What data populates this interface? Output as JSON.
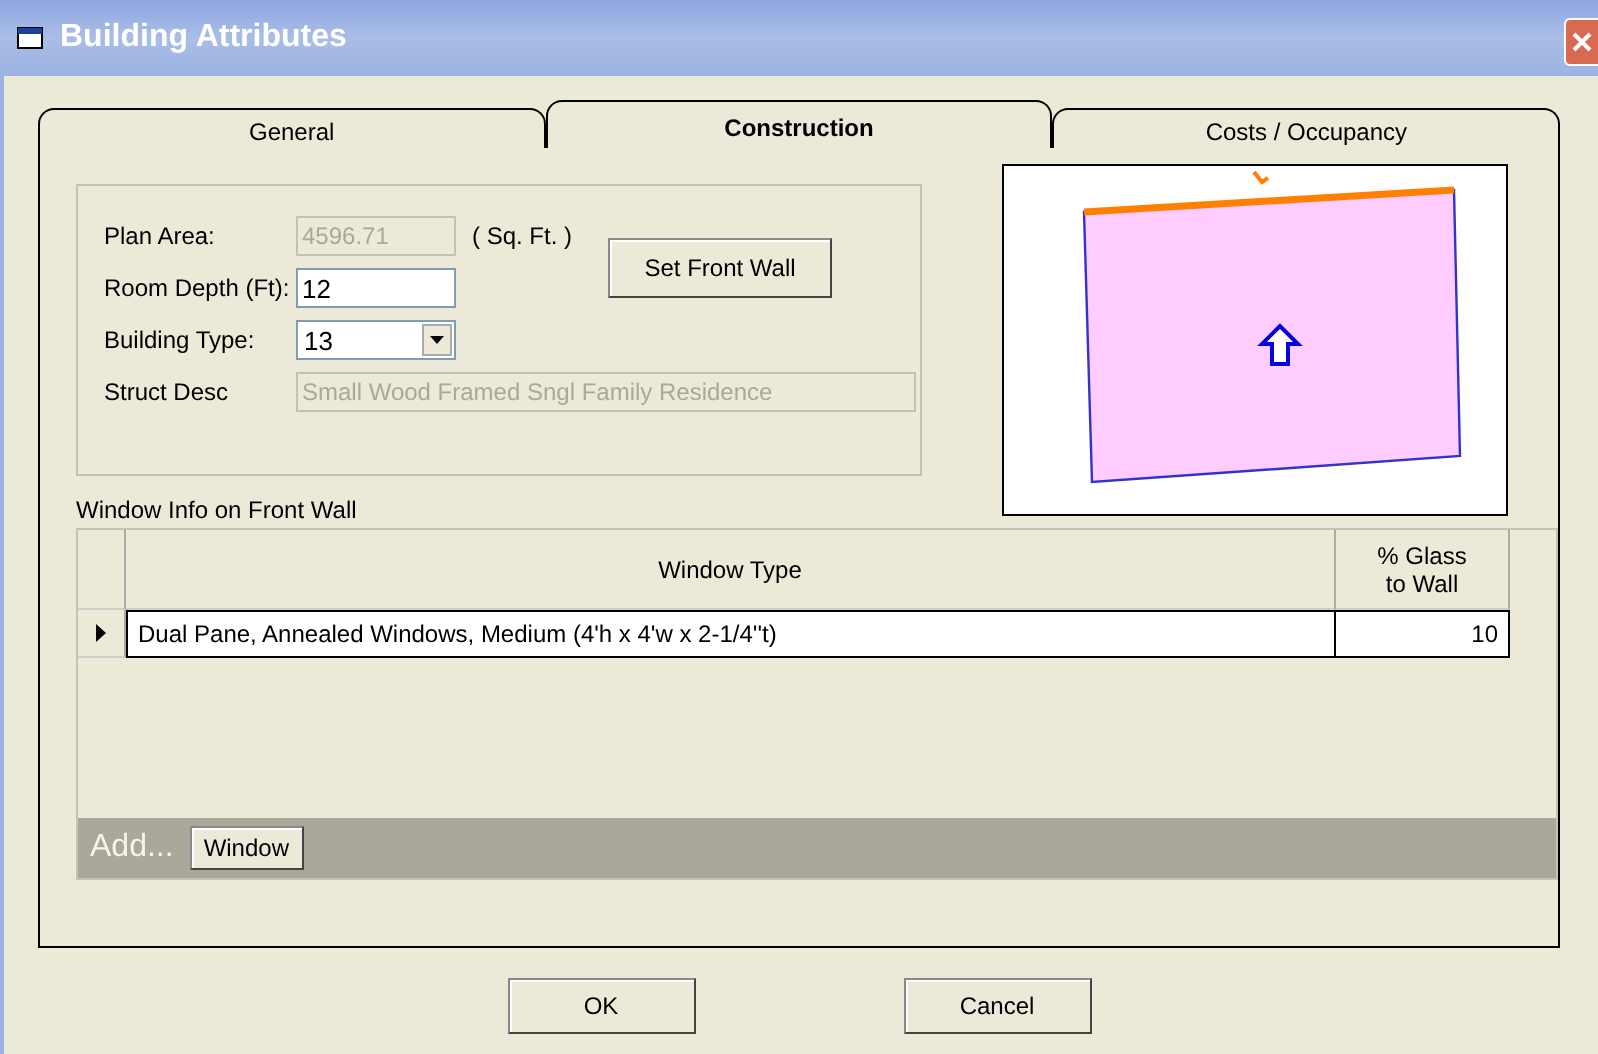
{
  "window": {
    "title": "Building Attributes"
  },
  "tabs": [
    {
      "label": "General",
      "selected": false
    },
    {
      "label": "Construction",
      "selected": true
    },
    {
      "label": "Costs / Occupancy",
      "selected": false
    }
  ],
  "form": {
    "plan_area": {
      "label": "Plan Area:",
      "value": "4596.71",
      "unit": "( Sq. Ft. )",
      "disabled": true
    },
    "room_depth": {
      "label": "Room Depth (Ft):",
      "value": "12"
    },
    "building_type": {
      "label": "Building Type:",
      "value": "13"
    },
    "struct_desc": {
      "label": "Struct Desc",
      "value": "Small Wood Framed Sngl Family Residence",
      "disabled": true
    },
    "set_front_wall": "Set Front Wall"
  },
  "window_info": {
    "title": "Window Info on Front Wall",
    "columns": [
      "Window Type",
      "% Glass to Wall"
    ],
    "rows": [
      {
        "window_type": "Dual Pane, Annealed Windows, Medium (4'h x 4'w x 2-1/4''t)",
        "glass": "10",
        "selected": true
      }
    ],
    "add_label": "Add...",
    "add_button": "Window"
  },
  "buttons": [
    "OK",
    "Cancel"
  ]
}
